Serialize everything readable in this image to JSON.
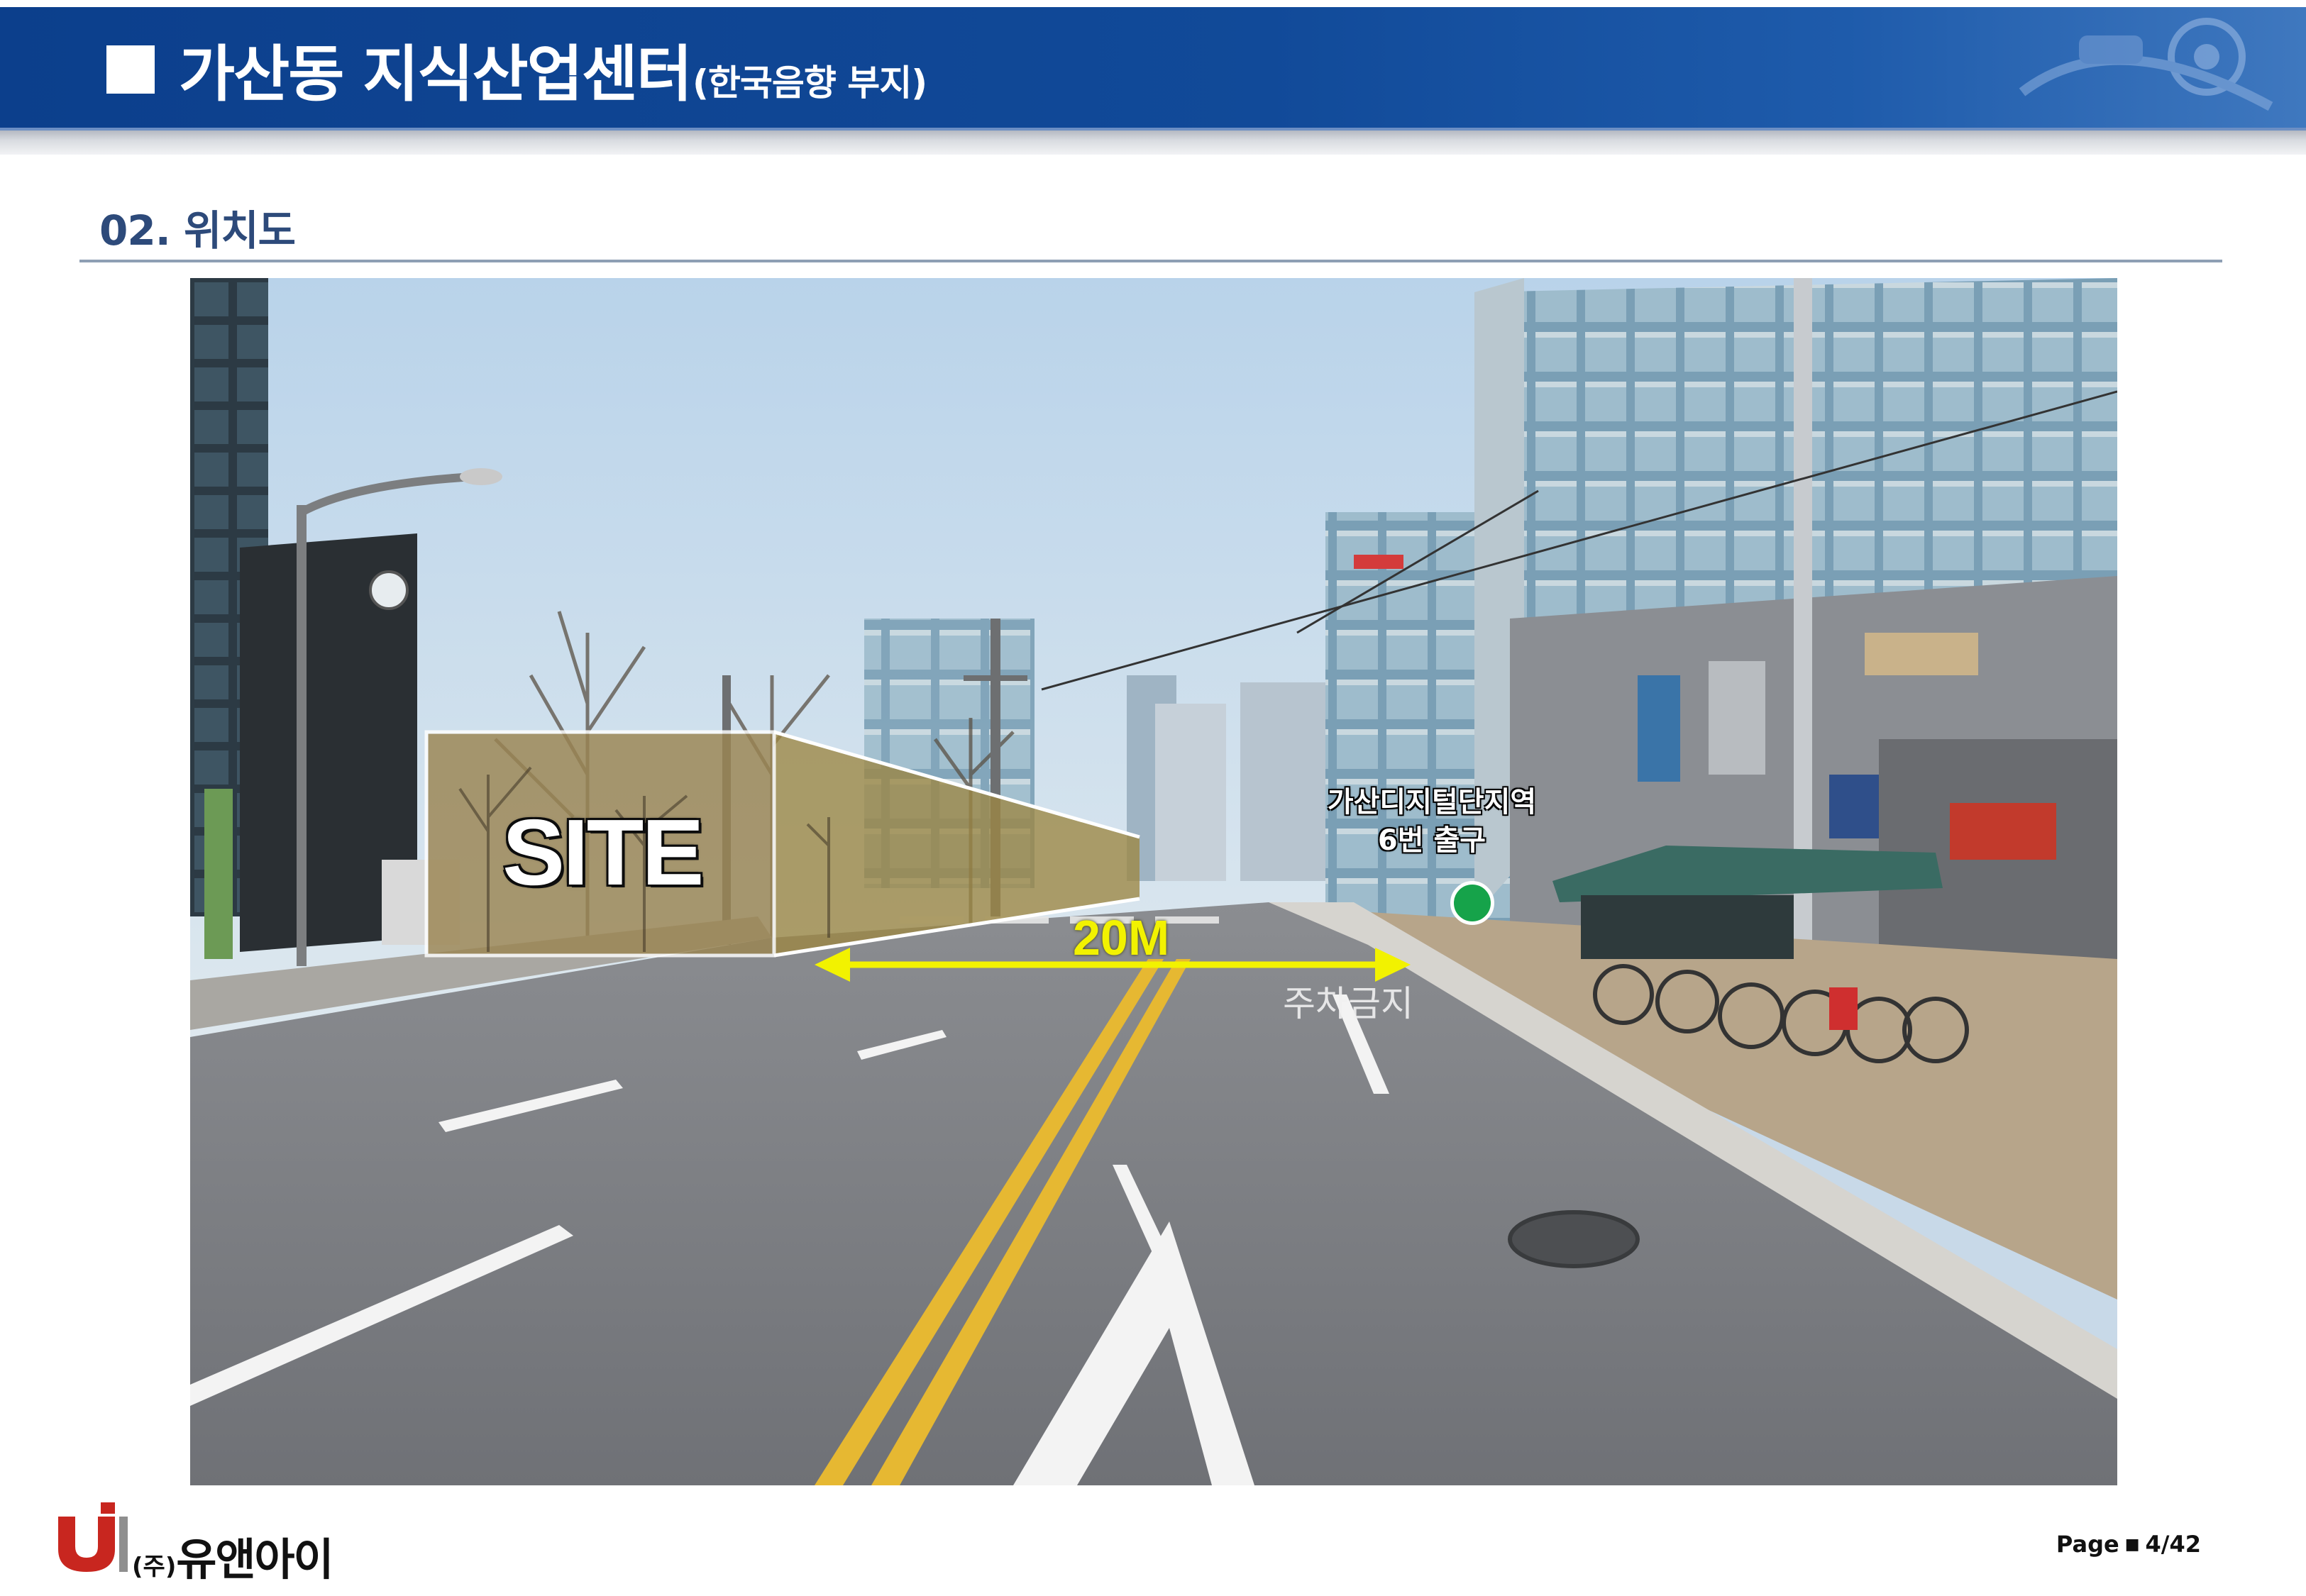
{
  "header": {
    "title": "가산동 지식산업센터",
    "subtitle": "(한국음향 부지)",
    "colors": {
      "banner": "#114a99",
      "text": "#ffffff"
    }
  },
  "section": {
    "heading": "02. 위치도"
  },
  "photo": {
    "site_label": "SITE",
    "distance_label": "20M",
    "station_label_line1": "가산디지털단지역",
    "station_label_line2": "6번 출구",
    "road_marking": "주차금지",
    "marker_color": "#16a34a",
    "arrow_color": "#f2f200"
  },
  "footer": {
    "company_prefix": "(주)",
    "company_name": "유앤아이",
    "page_prefix": "Page",
    "page_number": "4/42"
  }
}
